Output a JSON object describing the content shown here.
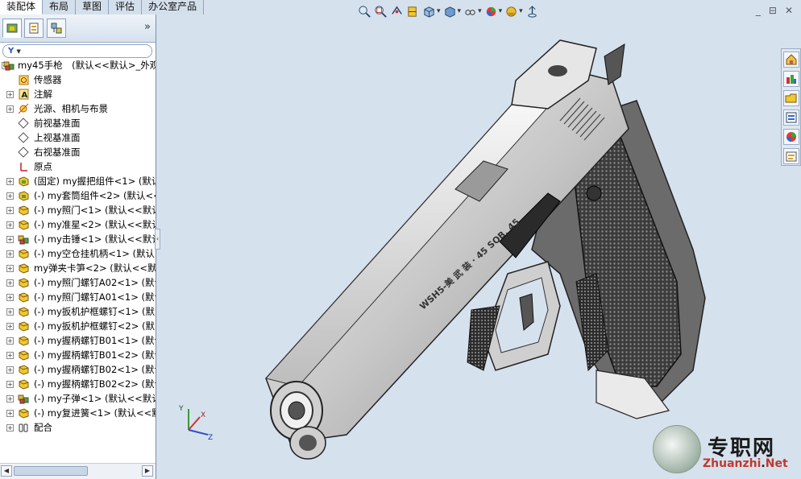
{
  "command_tabs": [
    "装配体",
    "布局",
    "草图",
    "评估",
    "办公室产品"
  ],
  "active_tab_index": 0,
  "panel": {
    "collapse_arrows": "»",
    "filter_symbol": "▼"
  },
  "tree": [
    {
      "label": "my45手枪　(默认<<默认>_外观",
      "icon": "assembly-icon",
      "indent": 0,
      "expander": true
    },
    {
      "label": "传感器",
      "icon": "sensor-icon",
      "indent": 1,
      "expander": false
    },
    {
      "label": "注解",
      "icon": "annotation-icon",
      "indent": 1,
      "expander": true
    },
    {
      "label": "光源、相机与布景",
      "icon": "lights-icon",
      "indent": 1,
      "expander": true
    },
    {
      "label": "前视基准面",
      "icon": "plane-icon",
      "indent": 1,
      "expander": false
    },
    {
      "label": "上视基准面",
      "icon": "plane-icon",
      "indent": 1,
      "expander": false
    },
    {
      "label": "右视基准面",
      "icon": "plane-icon",
      "indent": 1,
      "expander": false
    },
    {
      "label": "原点",
      "icon": "origin-icon",
      "indent": 1,
      "expander": false
    },
    {
      "label": "(固定) my握把组件<1> (默认",
      "icon": "subassembly-icon",
      "indent": 1,
      "expander": true
    },
    {
      "label": "(-) my套筒组件<2> (默认<<",
      "icon": "subassembly-icon",
      "indent": 1,
      "expander": true
    },
    {
      "label": "(-) my照门<1> (默认<<默认",
      "icon": "part-icon",
      "indent": 1,
      "expander": true
    },
    {
      "label": "(-) my准星<2> (默认<<默认",
      "icon": "part-icon",
      "indent": 1,
      "expander": true
    },
    {
      "label": "(-) my击锤<1> (默认<<默认",
      "icon": "assembly-icon",
      "indent": 1,
      "expander": true
    },
    {
      "label": "(-) my空仓挂机柄<1> (默认",
      "icon": "part-icon",
      "indent": 1,
      "expander": true
    },
    {
      "label": "my弹夹卡笋<2> (默认<<默认",
      "icon": "part-icon",
      "indent": 1,
      "expander": true
    },
    {
      "label": "(-) my照门螺钉A02<1> (默认",
      "icon": "part-icon",
      "indent": 1,
      "expander": true
    },
    {
      "label": "(-) my照门螺钉A01<1> (默认",
      "icon": "part-icon",
      "indent": 1,
      "expander": true
    },
    {
      "label": "(-) my扳机护框螺钉<1> (默",
      "icon": "part-icon",
      "indent": 1,
      "expander": true
    },
    {
      "label": "(-) my扳机护框螺钉<2> (默",
      "icon": "part-icon",
      "indent": 1,
      "expander": true
    },
    {
      "label": "(-) my握柄螺钉B01<1> (默认",
      "icon": "part-icon",
      "indent": 1,
      "expander": true
    },
    {
      "label": "(-) my握柄螺钉B01<2> (默认",
      "icon": "part-icon",
      "indent": 1,
      "expander": true
    },
    {
      "label": "(-) my握柄螺钉B02<1> (默认",
      "icon": "part-icon",
      "indent": 1,
      "expander": true
    },
    {
      "label": "(-) my握柄螺钉B02<2> (默认",
      "icon": "part-icon",
      "indent": 1,
      "expander": true
    },
    {
      "label": "(-) my子弹<1> (默认<<默认",
      "icon": "assembly-icon",
      "indent": 1,
      "expander": true
    },
    {
      "label": "(-) my复进簧<1> (默认<<默",
      "icon": "part-icon",
      "indent": 1,
      "expander": true
    },
    {
      "label": "配合",
      "icon": "mates-icon",
      "indent": 1,
      "expander": true
    }
  ],
  "view_toolbar": [
    {
      "icon": "zoom-to-fit-icon",
      "dropdown": false
    },
    {
      "icon": "zoom-to-area-icon",
      "dropdown": false
    },
    {
      "icon": "previous-view-icon",
      "dropdown": false
    },
    {
      "icon": "section-view-icon",
      "dropdown": false
    },
    {
      "icon": "view-orientation-icon",
      "dropdown": true
    },
    {
      "icon": "display-style-icon",
      "dropdown": true
    },
    {
      "icon": "hide-show-items-icon",
      "dropdown": true
    },
    {
      "icon": "edit-appearance-icon",
      "dropdown": true
    },
    {
      "icon": "apply-scene-icon",
      "dropdown": true
    },
    {
      "icon": "view-settings-icon",
      "dropdown": false
    }
  ],
  "window_controls": [
    "_",
    "⊟",
    "✕"
  ],
  "task_pane": [
    "home-icon",
    "resources-icon",
    "design-library-icon",
    "file-explorer-icon",
    "appearances-icon",
    "custom-properties-icon"
  ],
  "triad_labels": {
    "x": "X",
    "y": "Y",
    "z": "Z"
  },
  "gun_engraving": "WSH5-美 武 装 · 45 SOB. 45",
  "watermark": {
    "cn": "专职网",
    "en_main": "Zhuanzhi",
    "en_dot": ".",
    "en_tld": "Net"
  },
  "colors": {
    "accent": "#2a56a6",
    "panel_bg": "#ffffff",
    "viewport_bg": "#d6e1ee",
    "watermark_red": "#c0392b"
  }
}
